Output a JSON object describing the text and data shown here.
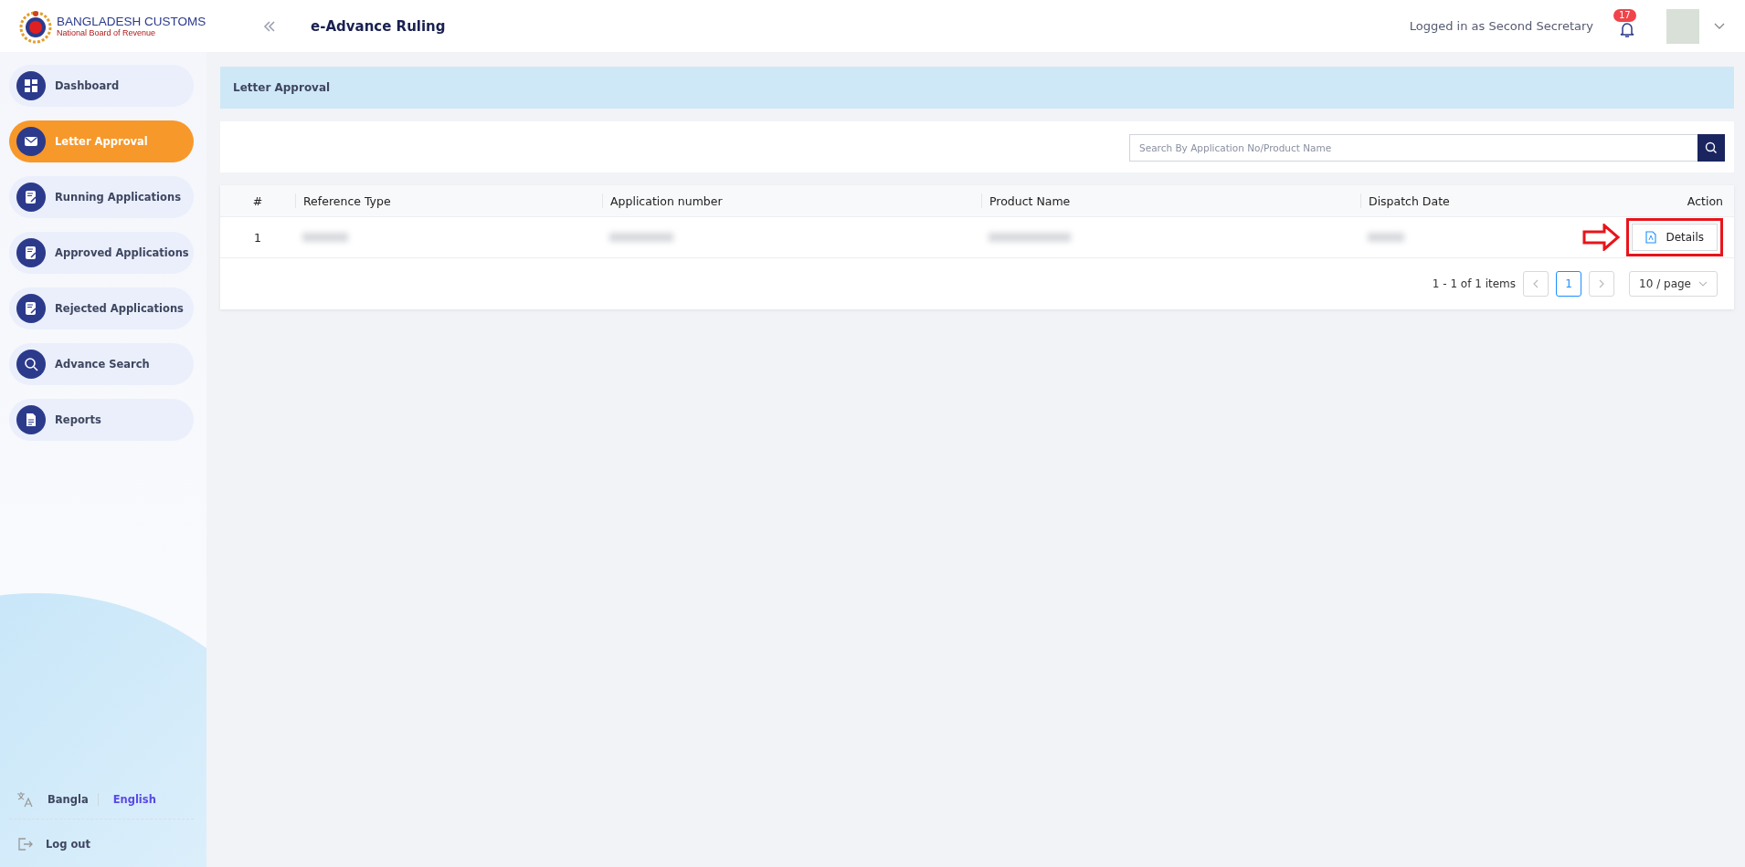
{
  "header": {
    "brand_title": "BANGLADESH CUSTOMS",
    "brand_subtitle": "National Board of Revenue",
    "app_title": "e-Advance Ruling",
    "logged_in": "Logged in as Second Secretary",
    "notification_count": "17"
  },
  "sidebar": {
    "items": [
      {
        "label": "Dashboard",
        "kind": "grid",
        "selected": false
      },
      {
        "label": "Letter Approval",
        "kind": "mail",
        "selected": true
      },
      {
        "label": "Running Applications",
        "kind": "form",
        "selected": false
      },
      {
        "label": "Approved Applications",
        "kind": "form",
        "selected": false
      },
      {
        "label": "Rejected Applications",
        "kind": "form",
        "selected": false
      },
      {
        "label": "Advance Search",
        "kind": "search",
        "selected": false
      },
      {
        "label": "Reports",
        "kind": "report",
        "selected": false
      }
    ],
    "languages": [
      {
        "label": "Bangla",
        "selected": false
      },
      {
        "label": "English",
        "selected": true
      }
    ],
    "logout": "Log out"
  },
  "page_title": "Letter Approval",
  "search": {
    "placeholder": "Search By Application No/Product Name"
  },
  "table": {
    "columns": [
      "#",
      "Reference Type",
      "Application number",
      "Product Name",
      "Dispatch Date",
      "Action"
    ],
    "rows": [
      {
        "index": "1",
        "action": "Details",
        "highlighted": true
      }
    ]
  },
  "pagination": {
    "summary": "1 - 1 of 1 items",
    "pages": [
      {
        "label": "1",
        "selected": true
      }
    ],
    "page_size": "10 / page"
  }
}
